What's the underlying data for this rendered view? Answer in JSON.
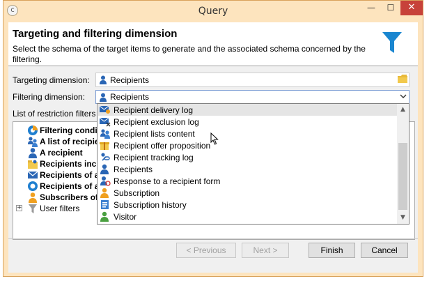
{
  "window": {
    "title": "Query",
    "app_icon": "app-icon",
    "minimize": "—",
    "maximize": "☐",
    "close": "✕"
  },
  "header": {
    "title": "Targeting and filtering dimension",
    "description": "Select the schema of the target items to  generate and the associated schema concerned by the filtering.",
    "icon": "funnel-icon"
  },
  "form": {
    "targeting_label": "Targeting dimension:",
    "targeting_value": "Recipients",
    "filtering_label": "Filtering dimension:",
    "filtering_value": "Recipients",
    "restriction_label": "List of restriction filters"
  },
  "tree": {
    "items": [
      {
        "label": "Filtering conditions",
        "icon": "filter-conditions-icon",
        "bold": true
      },
      {
        "label": "A list of recipients",
        "icon": "group-icon",
        "bold": true
      },
      {
        "label": "A recipient",
        "icon": "person-icon",
        "bold": true
      },
      {
        "label": "Recipients included",
        "icon": "folder-person-icon",
        "bold": true
      },
      {
        "label": "Recipients of a delivery",
        "icon": "envelope-icon",
        "bold": true
      },
      {
        "label": "Recipients of an offer",
        "icon": "offer-icon",
        "bold": true
      },
      {
        "label": "Subscribers of a service",
        "icon": "subscriber-icon",
        "bold": true
      },
      {
        "label": "User filters",
        "icon": "gray-funnel-icon",
        "bold": false
      }
    ],
    "expander": "+"
  },
  "dropdown": {
    "items": [
      {
        "label": "Recipient delivery log",
        "icon": "envelope-person-icon",
        "selected": true
      },
      {
        "label": "Recipient exclusion log",
        "icon": "envelope-cross-icon",
        "selected": false
      },
      {
        "label": "Recipient lists content",
        "icon": "group-icon",
        "selected": false
      },
      {
        "label": "Recipient offer proposition",
        "icon": "offer-gift-icon",
        "selected": false
      },
      {
        "label": "Recipient tracking log",
        "icon": "tracking-link-icon",
        "selected": false
      },
      {
        "label": "Recipients",
        "icon": "person-icon",
        "selected": false
      },
      {
        "label": "Response to a recipient form",
        "icon": "person-at-icon",
        "selected": false
      },
      {
        "label": "Subscription",
        "icon": "subscription-person-icon",
        "selected": false
      },
      {
        "label": "Subscription history",
        "icon": "history-doc-icon",
        "selected": false
      },
      {
        "label": "Visitor",
        "icon": "visitor-icon",
        "selected": false
      }
    ],
    "scroll_up": "▲",
    "scroll_down": "▼"
  },
  "buttons": {
    "previous": "< Previous",
    "next": "Next >",
    "finish": "Finish",
    "cancel": "Cancel"
  },
  "colors": {
    "title_bar": "#fde4be",
    "close_red": "#c7423a",
    "funnel_blue": "#1a86d0",
    "selection": "#e5e5e5"
  }
}
